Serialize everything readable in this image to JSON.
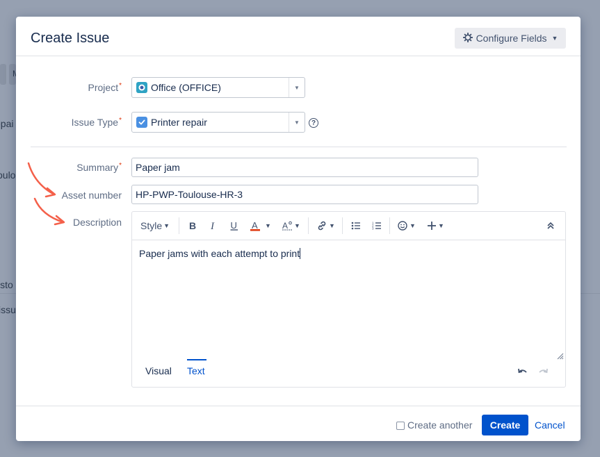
{
  "background": {
    "fragments": [
      "M",
      "epai",
      "oulo",
      "isto",
      "issu"
    ]
  },
  "dialog": {
    "title": "Create Issue",
    "configure_fields_label": "Configure Fields",
    "fields": {
      "project": {
        "label": "Project",
        "value": "Office (OFFICE)"
      },
      "issue_type": {
        "label": "Issue Type",
        "value": "Printer repair"
      },
      "summary": {
        "label": "Summary",
        "value": "Paper jam"
      },
      "asset_number": {
        "label": "Asset number",
        "value": "HP-PWP-Toulouse-HR-3"
      },
      "description": {
        "label": "Description",
        "value": "Paper jams with each attempt to print"
      }
    },
    "required_marker": "*",
    "editor": {
      "style_label": "Style",
      "tabs": {
        "visual": "Visual",
        "text": "Text"
      },
      "active_tab": "Text"
    },
    "footer": {
      "create_another_label": "Create another",
      "create_another_checked": false,
      "create_label": "Create",
      "cancel_label": "Cancel"
    }
  },
  "colors": {
    "primary": "#0052cc",
    "required": "#de350b",
    "annotation_arrow": "#f4604a",
    "overlay": "#96a0b1"
  }
}
